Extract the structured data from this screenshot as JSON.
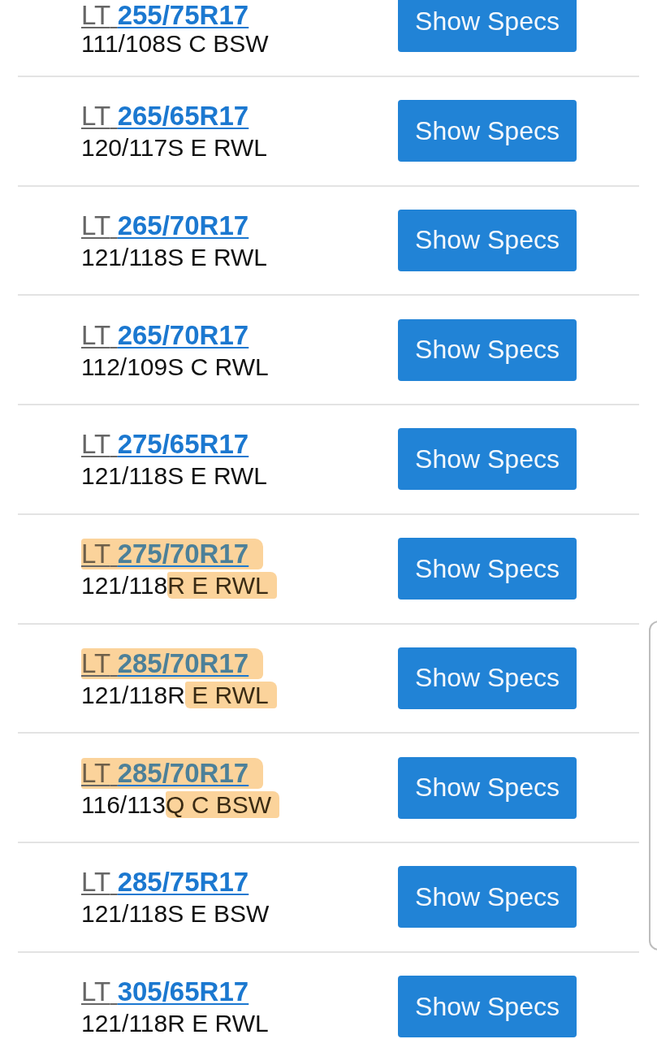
{
  "rows": [
    {
      "prefix": "LT",
      "size": "255/75R17",
      "spec": "111/108S C BSW",
      "highlighted": false,
      "button": "Show Specs"
    },
    {
      "prefix": "LT",
      "size": "265/65R17",
      "spec": "120/117S E RWL",
      "highlighted": false,
      "button": "Show Specs"
    },
    {
      "prefix": "LT",
      "size": "265/70R17",
      "spec": "121/118S E RWL",
      "highlighted": false,
      "button": "Show Specs"
    },
    {
      "prefix": "LT",
      "size": "265/70R17",
      "spec": "112/109S C RWL",
      "highlighted": false,
      "button": "Show Specs"
    },
    {
      "prefix": "LT",
      "size": "275/65R17",
      "spec": "121/118S E RWL",
      "highlighted": false,
      "button": "Show Specs"
    },
    {
      "prefix": "LT",
      "size": "275/70R17",
      "spec": "121/118",
      "spec_marked": "R E RWL",
      "highlighted": true,
      "button": "Show Specs"
    },
    {
      "prefix": "LT",
      "size": "285/70R17",
      "spec": "121/118R",
      "spec_marked": " E RWL",
      "highlighted": true,
      "button": "Show Specs"
    },
    {
      "prefix": "LT",
      "size": "285/70R17",
      "spec": "116/113",
      "spec_marked": "Q C BSW",
      "highlighted": true,
      "button": "Show Specs"
    },
    {
      "prefix": "LT",
      "size": "285/75R17",
      "spec": "121/118S E BSW",
      "highlighted": false,
      "button": "Show Specs"
    },
    {
      "prefix": "LT",
      "size": "305/65R17",
      "spec": "121/118R E RWL",
      "highlighted": false,
      "button": "Show Specs"
    }
  ]
}
